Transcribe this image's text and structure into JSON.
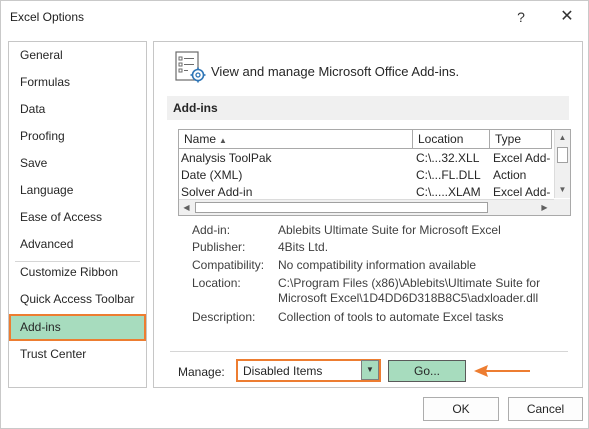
{
  "window": {
    "title": "Excel Options",
    "help_glyph": "?",
    "close_glyph": "✕"
  },
  "nav": {
    "items": [
      {
        "label": "General"
      },
      {
        "label": "Formulas"
      },
      {
        "label": "Data"
      },
      {
        "label": "Proofing"
      },
      {
        "label": "Save"
      },
      {
        "label": "Language"
      },
      {
        "label": "Ease of Access"
      },
      {
        "label": "Advanced"
      },
      {
        "label": "Customize Ribbon"
      },
      {
        "label": "Quick Access Toolbar"
      },
      {
        "label": "Add-ins",
        "selected": true
      },
      {
        "label": "Trust Center"
      }
    ]
  },
  "header": {
    "icon": "add-ins-settings-icon",
    "text": "View and manage Microsoft Office Add-ins."
  },
  "section": {
    "title": "Add-ins"
  },
  "addins_table": {
    "columns": [
      "Name",
      "Location",
      "Type"
    ],
    "sort_indicator": "▲",
    "rows": [
      {
        "name": "Analysis ToolPak",
        "location": "C:\\...32.XLL",
        "type": "Excel Add-"
      },
      {
        "name": "Date (XML)",
        "location": "C:\\...FL.DLL",
        "type": "Action"
      },
      {
        "name": "Solver Add-in",
        "location": "C:\\.....XLAM",
        "type": "Excel Add-"
      }
    ],
    "scroll_up": "▲",
    "scroll_down": "▼",
    "scroll_left": "◀",
    "scroll_right": "▶"
  },
  "details": {
    "addin_label": "Add-in:",
    "addin_value": "Ablebits Ultimate Suite for Microsoft Excel",
    "publisher_label": "Publisher:",
    "publisher_value": "4Bits Ltd.",
    "compat_label": "Compatibility:",
    "compat_value": "No compatibility information available",
    "location_label": "Location:",
    "location_line1": "C:\\Program Files (x86)\\Ablebits\\Ultimate Suite for",
    "location_line2": "Microsoft Excel\\1D4DD6D318B8C5\\adxloader.dll",
    "description_label": "Description:",
    "description_value": "Collection of tools to automate Excel tasks"
  },
  "manage": {
    "label": "Manage:",
    "selected": "Disabled Items",
    "dropdown_glyph": "▼",
    "go_label": "Go..."
  },
  "footer": {
    "ok_label": "OK",
    "cancel_label": "Cancel"
  },
  "colors": {
    "highlight_green": "#a7dcbe",
    "annotation_orange": "#ed7d31"
  }
}
